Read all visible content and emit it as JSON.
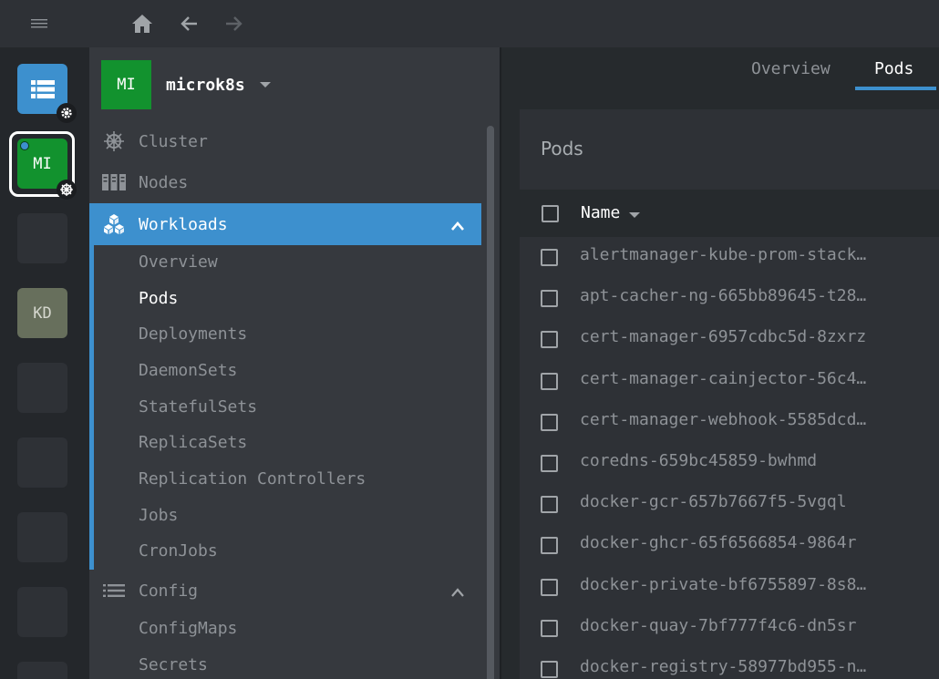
{
  "hotbar": {
    "items": [
      {
        "label": "MI",
        "color": "#12922e"
      },
      {
        "label": "KD",
        "color": "#676f5c"
      }
    ]
  },
  "sidebar": {
    "cluster": {
      "avatar": "MI",
      "name": "microk8s",
      "color": "#12922e"
    },
    "nav": {
      "cluster": "Cluster",
      "nodes": "Nodes",
      "workloads": "Workloads",
      "config": "Config"
    },
    "workloads_items": [
      "Overview",
      "Pods",
      "Deployments",
      "DaemonSets",
      "StatefulSets",
      "ReplicaSets",
      "Replication Controllers",
      "Jobs",
      "CronJobs"
    ],
    "config_items": [
      "ConfigMaps",
      "Secrets"
    ]
  },
  "tabs": [
    "Overview",
    "Pods"
  ],
  "panel": {
    "title": "Pods",
    "column_name": "Name",
    "rows": [
      "alertmanager-kube-prom-stack…",
      "apt-cacher-ng-665bb89645-t28…",
      "cert-manager-6957cdbc5d-8zxrz",
      "cert-manager-cainjector-56c4…",
      "cert-manager-webhook-5585dcd…",
      "coredns-659bc45859-bwhmd",
      "docker-gcr-657b7667f5-5vgql",
      "docker-ghcr-65f6566854-9864r",
      "docker-private-bf6755897-8s8…",
      "docker-quay-7bf777f4c6-dn5sr",
      "docker-registry-58977bd955-n…"
    ]
  },
  "colors": {
    "accent": "#3d90ce",
    "cluster_green": "#12922e"
  }
}
